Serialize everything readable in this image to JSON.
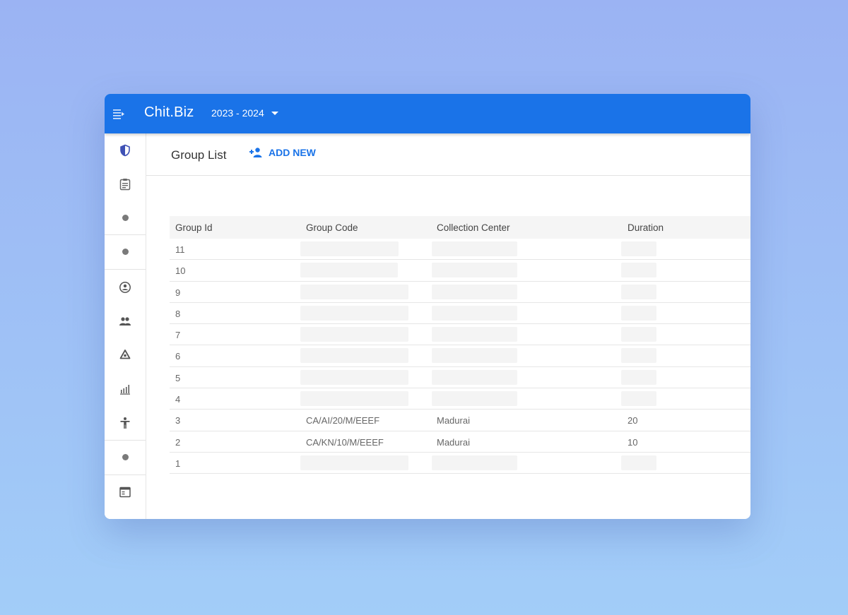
{
  "app": {
    "title": "Chit.Biz",
    "financial_year": "2023 - 2024"
  },
  "page": {
    "title": "Group List",
    "add_new_label": "ADD NEW"
  },
  "sidebar": {
    "items": [
      {
        "icon": "shield-icon"
      },
      {
        "icon": "clipboard-icon"
      },
      {
        "icon": "dot-icon"
      },
      {
        "icon": "dot-icon"
      },
      {
        "icon": "account-circle-icon"
      },
      {
        "icon": "people-icon"
      },
      {
        "icon": "recycle-icon"
      },
      {
        "icon": "bar-chart-icon"
      },
      {
        "icon": "accessibility-icon"
      },
      {
        "icon": "dot-icon"
      },
      {
        "icon": "calendar-view-icon"
      }
    ]
  },
  "table": {
    "columns": [
      "Group Id",
      "Group Code",
      "Collection Center",
      "Duration"
    ],
    "rows": [
      {
        "id": "11",
        "code": "",
        "center": "",
        "duration": ""
      },
      {
        "id": "10",
        "code": "",
        "center": "",
        "duration": ""
      },
      {
        "id": "9",
        "code": "",
        "center": "",
        "duration": ""
      },
      {
        "id": "8",
        "code": "",
        "center": "",
        "duration": ""
      },
      {
        "id": "7",
        "code": "",
        "center": "",
        "duration": ""
      },
      {
        "id": "6",
        "code": "",
        "center": "",
        "duration": ""
      },
      {
        "id": "5",
        "code": "",
        "center": "",
        "duration": ""
      },
      {
        "id": "4",
        "code": "",
        "center": "",
        "duration": ""
      },
      {
        "id": "3",
        "code": "CA/AI/20/M/EEEF",
        "center": "Madurai",
        "duration": "20"
      },
      {
        "id": "2",
        "code": "CA/KN/10/M/EEEF",
        "center": "Madurai",
        "duration": "10"
      },
      {
        "id": "1",
        "code": "",
        "center": "",
        "duration": ""
      }
    ]
  },
  "colors": {
    "primary": "#1a73e8",
    "background_top": "#9bb3f3",
    "background_bottom": "#a2cdf8"
  }
}
